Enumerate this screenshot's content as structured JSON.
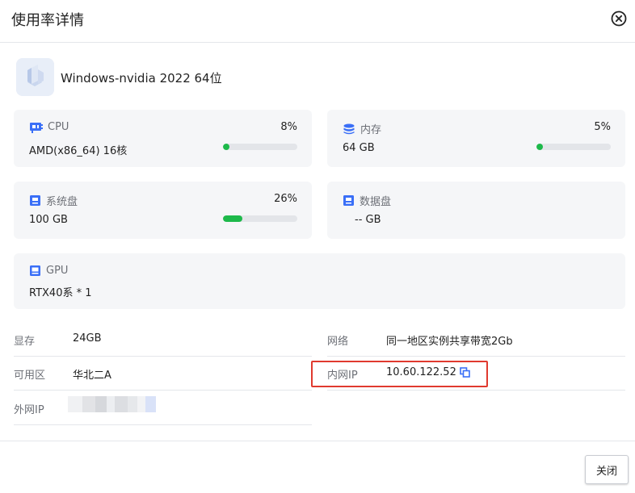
{
  "dialog": {
    "title": "使用率详情"
  },
  "os": {
    "name": "Windows-nvidia 2022 64位"
  },
  "cards": {
    "cpu": {
      "label": "CPU",
      "percent_text": "8%",
      "value": "AMD(x86_64) 16核",
      "usage": 0.08
    },
    "memory": {
      "label": "内存",
      "percent_text": "5%",
      "value": "64 GB",
      "usage": 0.05
    },
    "system_disk": {
      "label": "系统盘",
      "percent_text": "26%",
      "value": "100 GB",
      "usage": 0.26
    },
    "data_disk": {
      "label": "数据盘",
      "value": "-- GB"
    },
    "gpu": {
      "label": "GPU",
      "value": "RTX40系 * 1"
    }
  },
  "info": {
    "vram": {
      "key": "显存",
      "value": "24GB"
    },
    "network": {
      "key": "网络",
      "value": "同一地区实例共享带宽2Gb"
    },
    "zone": {
      "key": "可用区",
      "value": "华北二A"
    },
    "private_ip": {
      "key": "内网IP",
      "value": "10.60.122.52"
    },
    "public_ip": {
      "key": "外网IP"
    }
  },
  "footer": {
    "close_label": "关闭"
  },
  "colors": {
    "accent": "#3a6ff7",
    "usage_fill": "#1db94a",
    "highlight": "#e03a2f",
    "card_bg": "#f5f6f8"
  },
  "icons": [
    "close-circle-icon",
    "windows-os-icon",
    "cpu-icon",
    "memory-icon",
    "disk-icon",
    "gpu-icon",
    "copy-icon"
  ]
}
